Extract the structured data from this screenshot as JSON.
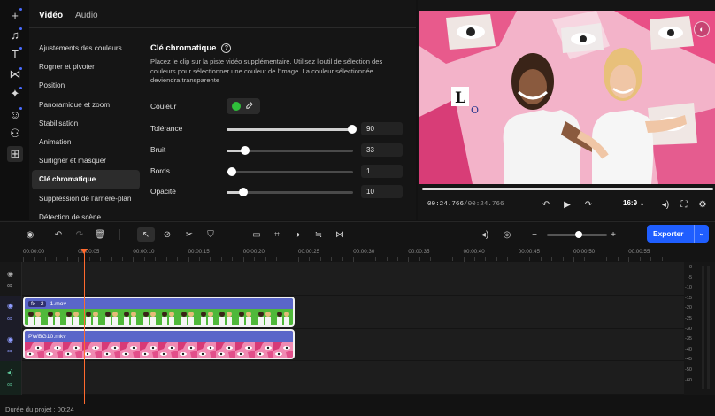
{
  "toolbar": {
    "items": [
      {
        "name": "add-media-icon",
        "glyph": "+"
      },
      {
        "name": "music-icon",
        "glyph": "♫"
      },
      {
        "name": "text-icon",
        "glyph": "T"
      },
      {
        "name": "transitions-icon",
        "glyph": "⋈"
      },
      {
        "name": "effects-icon",
        "glyph": "✦"
      },
      {
        "name": "stickers-icon",
        "glyph": "☺"
      },
      {
        "name": "templates-icon",
        "glyph": "⚇"
      },
      {
        "name": "tools-icon",
        "glyph": "⊞"
      }
    ]
  },
  "settings": {
    "tabs": [
      "Vidéo",
      "Audio"
    ],
    "menu": [
      "Ajustements des couleurs",
      "Rogner et pivoter",
      "Position",
      "Panoramique et zoom",
      "Stabilisation",
      "Animation",
      "Surligner et masquer",
      "Clé chromatique",
      "Suppression de l'arrière-plan",
      "Détection de scène"
    ],
    "active_menu": "Clé chromatique",
    "section_title": "Clé chromatique",
    "description": "Placez le clip sur la piste vidéo supplémentaire. Utilisez l'outil de sélection des couleurs pour sélectionner une couleur de l'image. La couleur sélectionnée deviendra transparente",
    "color_label": "Couleur",
    "color_value": "#2fbf3a",
    "sliders": [
      {
        "label": "Tolérance",
        "value": "90",
        "fraction": 0.99
      },
      {
        "label": "Bruit",
        "value": "33",
        "fraction": 0.15
      },
      {
        "label": "Bords",
        "value": "1",
        "fraction": 0.04
      },
      {
        "label": "Opacité",
        "value": "10",
        "fraction": 0.13
      }
    ]
  },
  "preview": {
    "current_time": "00:24.766",
    "separator": "/",
    "duration": "00:24.766",
    "ratio": "16:9",
    "progress": 1.0,
    "scene_letters": [
      "L",
      "O"
    ]
  },
  "timeline": {
    "export_label": "Exporter",
    "zoom_fraction": 0.53,
    "ticks": [
      "00:00:00",
      "00:00:05",
      "00:00:10",
      "00:00:15",
      "00:00:20",
      "00:00:25",
      "00:00:30",
      "00:00:35",
      "00:00:40",
      "00:00:45",
      "00:00:50",
      "00:00:55"
    ],
    "clip_top": {
      "fx": "fx · 2",
      "name": "1.mov"
    },
    "clip_bottom": {
      "name": "PWBG10.mkv"
    },
    "vu_labels": [
      "0",
      "-5",
      "-10",
      "-15",
      "-20",
      "-25",
      "-30",
      "-35",
      "-40",
      "-45",
      "-50",
      "-60"
    ]
  },
  "footer": {
    "project_duration": "Durée du projet : 00:24"
  }
}
